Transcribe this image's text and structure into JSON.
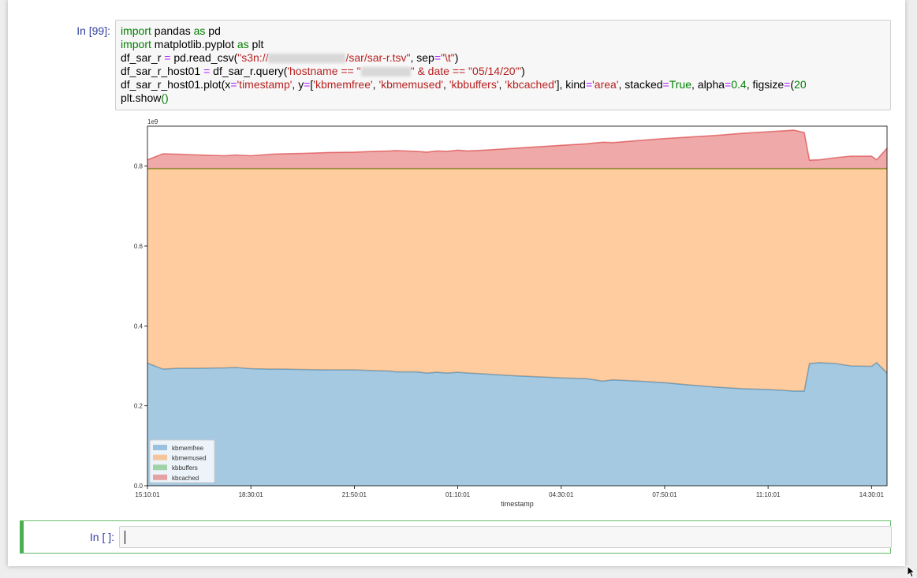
{
  "cells": [
    {
      "prompt": "In [99]:",
      "code_lines": [
        [
          {
            "t": "import",
            "c": "kw"
          },
          {
            "t": " pandas ",
            "c": ""
          },
          {
            "t": "as",
            "c": "kw"
          },
          {
            "t": " pd",
            "c": ""
          }
        ],
        [
          {
            "t": "import",
            "c": "kw"
          },
          {
            "t": " matplotlib.pyplot ",
            "c": ""
          },
          {
            "t": "as",
            "c": "kw"
          },
          {
            "t": " plt",
            "c": ""
          }
        ],
        [
          {
            "t": "df_sar_r ",
            "c": ""
          },
          {
            "t": "=",
            "c": "op"
          },
          {
            "t": " pd.read_csv(",
            "c": ""
          },
          {
            "t": "\"s3n://",
            "c": "str"
          },
          {
            "t": "xxxxxxxxxxxxxx",
            "c": "redact"
          },
          {
            "t": "/sar/sar-r.tsv\"",
            "c": "str"
          },
          {
            "t": ", sep",
            "c": ""
          },
          {
            "t": "=",
            "c": "op"
          },
          {
            "t": "\"\\t\"",
            "c": "str"
          },
          {
            "t": ")",
            "c": ""
          }
        ],
        [
          {
            "t": "df_sar_r_host01 ",
            "c": ""
          },
          {
            "t": "=",
            "c": "op"
          },
          {
            "t": " df_sar_r.query(",
            "c": ""
          },
          {
            "t": "'hostname == \"",
            "c": "str"
          },
          {
            "t": "xxxxxxxxx",
            "c": "redact"
          },
          {
            "t": "\" & date == \"05/14/20\"'",
            "c": "str"
          },
          {
            "t": ")",
            "c": ""
          }
        ],
        [
          {
            "t": "df_sar_r_host01.plot(x",
            "c": ""
          },
          {
            "t": "=",
            "c": "op"
          },
          {
            "t": "'timestamp'",
            "c": "str"
          },
          {
            "t": ", y",
            "c": ""
          },
          {
            "t": "=",
            "c": "op"
          },
          {
            "t": "[",
            "c": ""
          },
          {
            "t": "'kbmemfree'",
            "c": "str"
          },
          {
            "t": ", ",
            "c": ""
          },
          {
            "t": "'kbmemused'",
            "c": "str"
          },
          {
            "t": ", ",
            "c": ""
          },
          {
            "t": "'kbbuffers'",
            "c": "str"
          },
          {
            "t": ", ",
            "c": ""
          },
          {
            "t": "'kbcached'",
            "c": "str"
          },
          {
            "t": "], kind",
            "c": ""
          },
          {
            "t": "=",
            "c": "op"
          },
          {
            "t": "'area'",
            "c": "str"
          },
          {
            "t": ", stacked",
            "c": ""
          },
          {
            "t": "=",
            "c": "op"
          },
          {
            "t": "True",
            "c": "kw"
          },
          {
            "t": ", alpha",
            "c": ""
          },
          {
            "t": "=",
            "c": "op"
          },
          {
            "t": "0.4",
            "c": "num"
          },
          {
            "t": ", figsize",
            "c": ""
          },
          {
            "t": "=",
            "c": "op"
          },
          {
            "t": "(",
            "c": ""
          },
          {
            "t": "20",
            "c": "num"
          }
        ],
        [
          {
            "t": "plt.show",
            "c": ""
          },
          {
            "t": "()",
            "c": "kw"
          }
        ]
      ]
    },
    {
      "prompt": "In [ ]:",
      "input_value": ""
    }
  ],
  "chart_data": {
    "type": "area",
    "stacked": true,
    "xlabel": "timestamp",
    "ylabel": "",
    "y_offset_label": "1e9",
    "ylim": [
      0,
      0.9
    ],
    "yticks": [
      0.0,
      0.2,
      0.4,
      0.6,
      0.8
    ],
    "ytick_labels": [
      "0.0",
      "0.2",
      "0.4",
      "0.6",
      "0.8"
    ],
    "xtick_labels": [
      "15:10:01",
      "18:30:01",
      "21:50:01",
      "01:10:01",
      "04:30:01",
      "07:50:01",
      "11:10:01",
      "14:30:01"
    ],
    "xtick_positions": [
      0,
      20,
      40,
      60,
      80,
      100,
      120,
      140
    ],
    "x_count": 144,
    "legend_position": "lower left",
    "grid": false,
    "alpha": 0.4,
    "x": [
      0,
      3,
      6,
      10,
      15,
      17,
      20,
      24,
      26,
      30,
      35,
      40,
      44,
      47,
      48,
      52,
      54,
      56,
      58,
      60,
      62,
      65,
      70,
      75,
      80,
      85,
      88,
      90,
      95,
      100,
      105,
      110,
      115,
      120,
      125,
      127,
      128,
      130,
      133,
      136,
      140,
      141,
      143
    ],
    "series": [
      {
        "name": "kbmemfree",
        "color": "#1f77b4",
        "values": [
          0.307,
          0.292,
          0.294,
          0.294,
          0.295,
          0.296,
          0.293,
          0.292,
          0.292,
          0.291,
          0.29,
          0.29,
          0.288,
          0.287,
          0.285,
          0.285,
          0.282,
          0.284,
          0.282,
          0.284,
          0.282,
          0.28,
          0.276,
          0.273,
          0.27,
          0.268,
          0.262,
          0.265,
          0.262,
          0.258,
          0.252,
          0.247,
          0.243,
          0.241,
          0.237,
          0.237,
          0.306,
          0.308,
          0.306,
          0.3,
          0.299,
          0.308,
          0.282
        ]
      },
      {
        "name": "kbmemused",
        "color": "#ff7f0e",
        "values": [
          0.486,
          0.501,
          0.499,
          0.499,
          0.498,
          0.497,
          0.5,
          0.501,
          0.501,
          0.502,
          0.503,
          0.503,
          0.505,
          0.506,
          0.508,
          0.508,
          0.511,
          0.509,
          0.511,
          0.509,
          0.511,
          0.513,
          0.517,
          0.52,
          0.523,
          0.525,
          0.531,
          0.528,
          0.531,
          0.535,
          0.541,
          0.546,
          0.55,
          0.552,
          0.556,
          0.556,
          0.487,
          0.485,
          0.487,
          0.493,
          0.494,
          0.485,
          0.511
        ]
      },
      {
        "name": "kbbuffers",
        "color": "#2ca02c",
        "values": [
          0.001,
          0.001,
          0.001,
          0.001,
          0.001,
          0.001,
          0.001,
          0.001,
          0.001,
          0.001,
          0.001,
          0.001,
          0.001,
          0.001,
          0.001,
          0.001,
          0.001,
          0.001,
          0.001,
          0.001,
          0.001,
          0.001,
          0.001,
          0.001,
          0.001,
          0.001,
          0.001,
          0.001,
          0.001,
          0.001,
          0.001,
          0.001,
          0.001,
          0.001,
          0.001,
          0.001,
          0.001,
          0.001,
          0.001,
          0.001,
          0.001,
          0.001,
          0.001
        ]
      },
      {
        "name": "kbcached",
        "color": "#d62728",
        "values": [
          0.022,
          0.037,
          0.036,
          0.034,
          0.032,
          0.034,
          0.032,
          0.036,
          0.037,
          0.038,
          0.04,
          0.041,
          0.043,
          0.044,
          0.045,
          0.043,
          0.041,
          0.044,
          0.043,
          0.046,
          0.044,
          0.046,
          0.05,
          0.054,
          0.058,
          0.062,
          0.066,
          0.065,
          0.07,
          0.075,
          0.079,
          0.083,
          0.088,
          0.092,
          0.096,
          0.09,
          0.021,
          0.022,
          0.027,
          0.031,
          0.031,
          0.022,
          0.051
        ]
      }
    ]
  }
}
